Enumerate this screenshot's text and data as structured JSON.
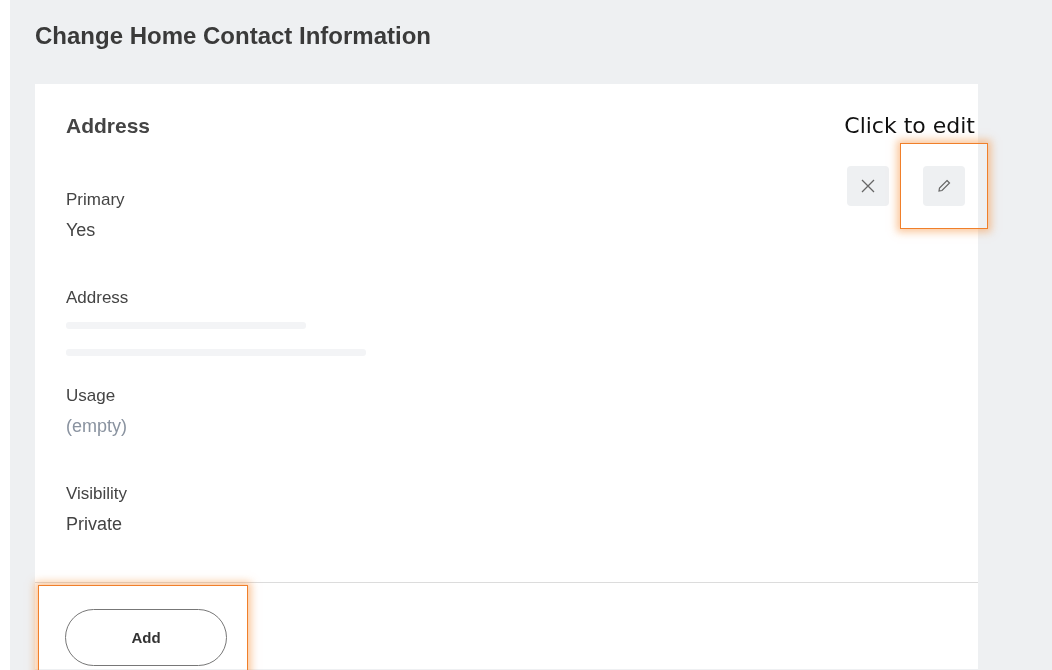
{
  "page": {
    "title": "Change Home Contact Information"
  },
  "card": {
    "title": "Address",
    "annotation": "Click to edit",
    "actions": [
      {
        "kind": "remove",
        "highlighted": false
      },
      {
        "kind": "edit",
        "highlighted": true
      }
    ],
    "fields": [
      {
        "label": "Primary",
        "value": "Yes",
        "kind": "text"
      },
      {
        "label": "Address",
        "kind": "redacted"
      },
      {
        "label": "Usage",
        "value": "(empty)",
        "kind": "empty"
      },
      {
        "label": "Visibility",
        "value": "Private",
        "kind": "text"
      }
    ],
    "footer_button": {
      "label": "Add",
      "highlighted": true
    }
  }
}
